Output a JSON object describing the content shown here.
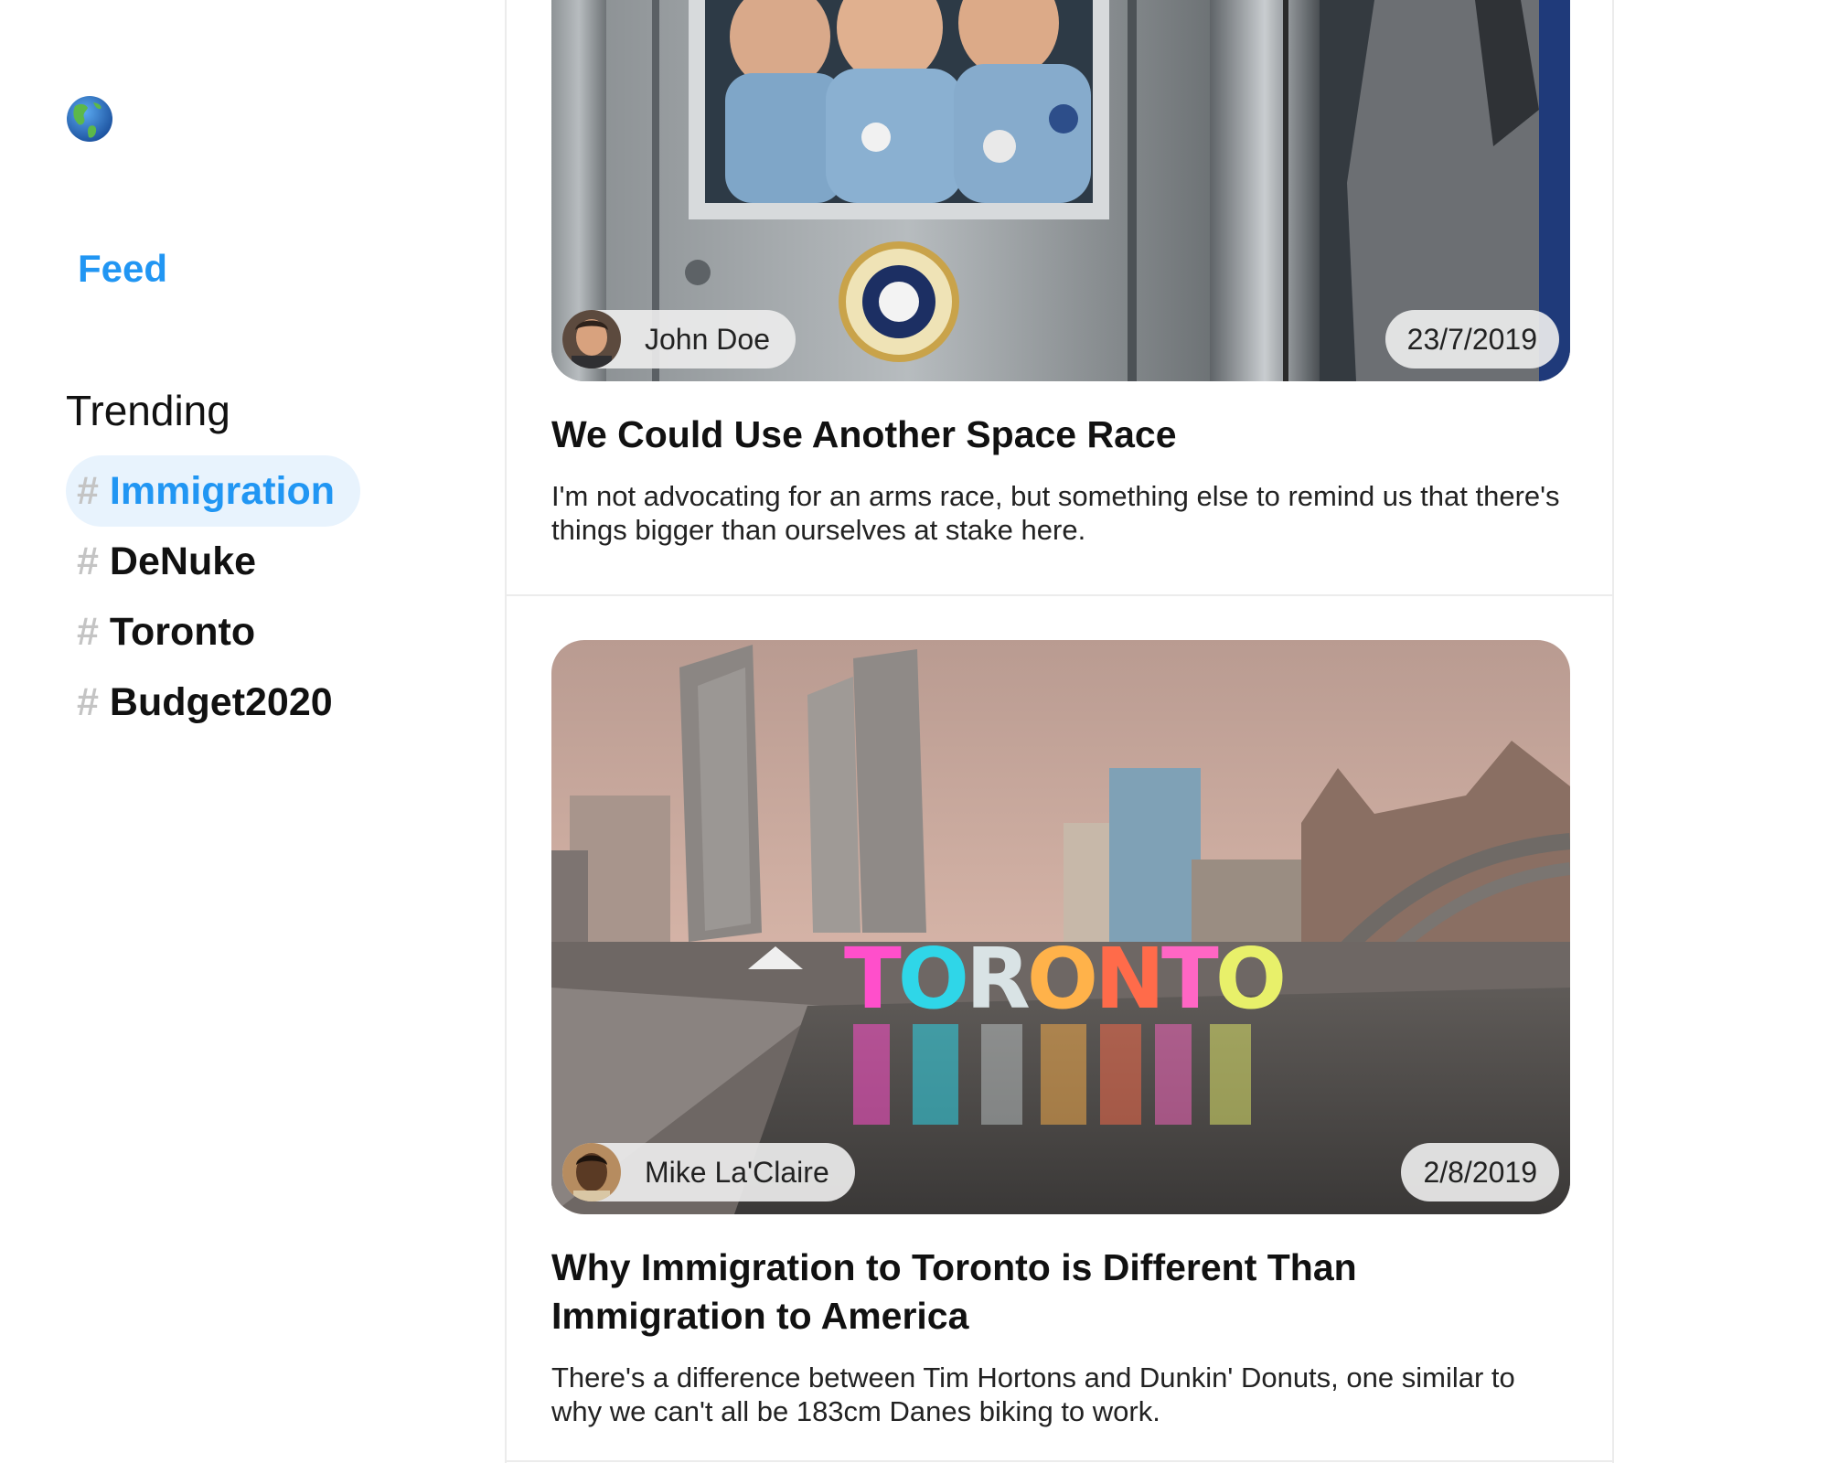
{
  "sidebar": {
    "logo_icon": "globe-americas-icon",
    "nav": {
      "feed_label": "Feed"
    },
    "trending": {
      "heading": "Trending",
      "hash_symbol": "#",
      "tags": [
        {
          "label": "Immigration",
          "active": true
        },
        {
          "label": "DeNuke",
          "active": false
        },
        {
          "label": "Toronto",
          "active": false
        },
        {
          "label": "Budget2020",
          "active": false
        }
      ]
    }
  },
  "feed": {
    "posts": [
      {
        "author": "John Doe",
        "date": "23/7/2019",
        "title": "We Could Use Another Space Race",
        "summary": "I'm not advocating for an arms race, but something else to remind us that there's things bigger than ourselves at stake here.",
        "image": "apollo-astronauts-quarantine-photo"
      },
      {
        "author": "Mike La'Claire",
        "date": "2/8/2019",
        "title": "Why Immigration to Toronto is Different Than Immigration to America",
        "summary": "There's a difference between Tim Hortons and Dunkin' Donuts, one similar to why we can't all be 183cm Danes biking to work.",
        "image": "toronto-city-hall-sign-photo",
        "image_sign_text": "TORONTO"
      }
    ]
  },
  "colors": {
    "accent": "#2196f3",
    "active_tag_bg": "#e8f3fd",
    "hash": "#c4c4c4",
    "divider": "#ececec"
  }
}
